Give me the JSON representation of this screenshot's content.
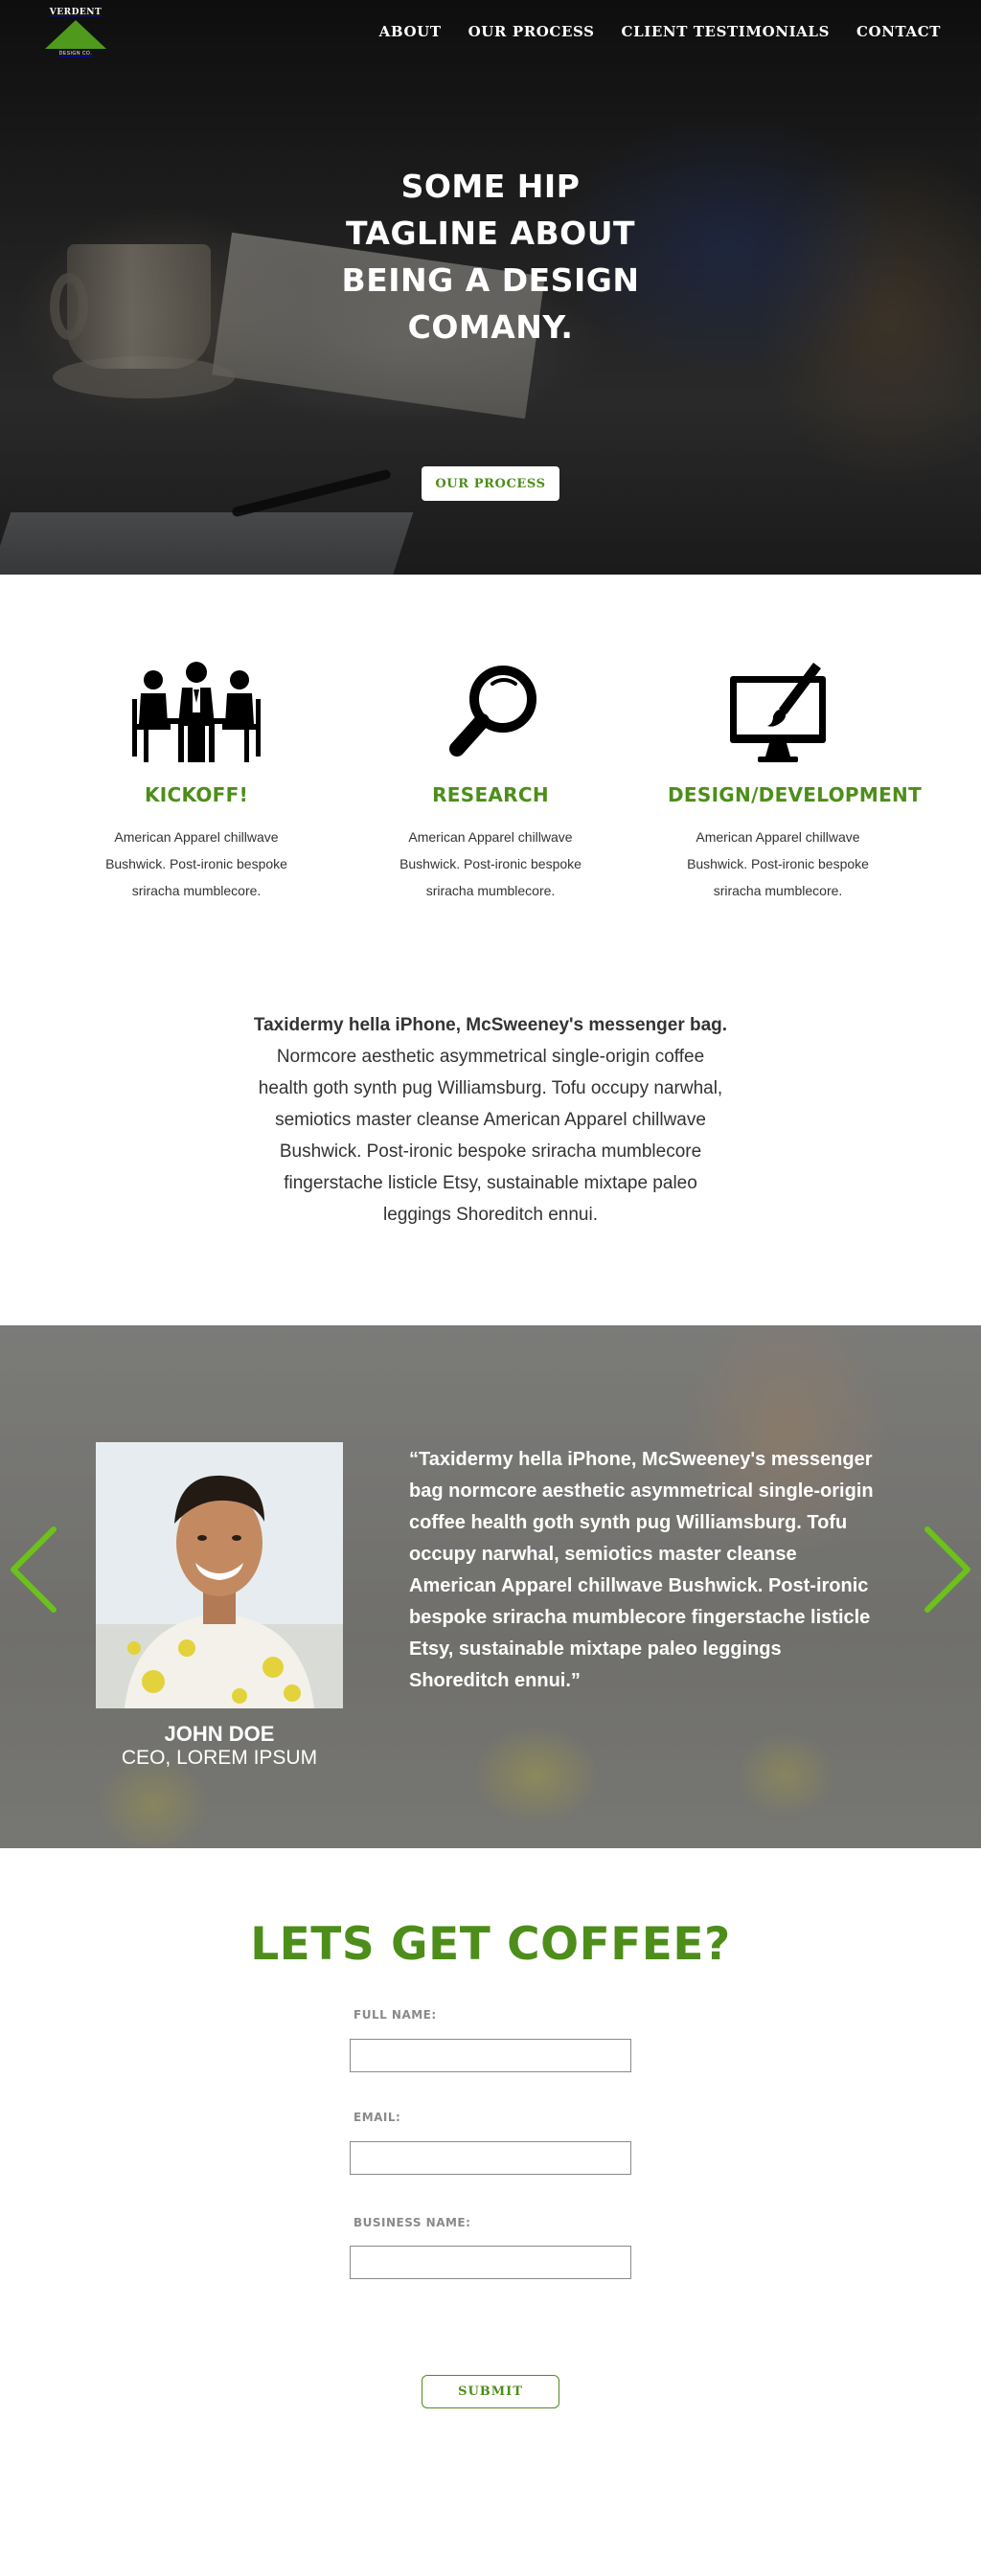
{
  "brand": {
    "name": "VERDENT",
    "sub": "DESIGN CO.",
    "accent": "#4d8e1a",
    "arrow_color": "#6cc11c"
  },
  "nav": {
    "items": [
      "ABOUT",
      "OUR PROCESS",
      "CLIENT TESTIMONIALS",
      "CONTACT"
    ]
  },
  "hero": {
    "tagline": {
      "w1": "SOME ",
      "w2": "HIP",
      "w3": "TAGLINE ABOUT",
      "w4": "BEING A ",
      "w5": "DESIGN",
      "w6": "COMANY."
    },
    "button_label": "OUR PROCESS"
  },
  "process": {
    "steps": [
      {
        "title": "KICKOFF!",
        "icon": "meeting-icon",
        "text": "American Apparel chillwave Bushwick. Post-ironic bespoke sriracha mumblecore."
      },
      {
        "title": "RESEARCH",
        "icon": "magnifier-icon",
        "text": "American Apparel chillwave Bushwick. Post-ironic bespoke sriracha mumblecore."
      },
      {
        "title": "DESIGN/DEVELOPMENT",
        "icon": "monitor-brush-icon",
        "text": "American Apparel chillwave Bushwick. Post-ironic bespoke sriracha mumblecore."
      }
    ]
  },
  "intro": {
    "heading": "Taxidermy hella iPhone, McSweeney's messenger bag.",
    "body": "Normcore aesthetic asymmetrical single-origin coffee health goth synth pug Williamsburg. Tofu occupy narwhal, semiotics master cleanse American Apparel chillwave Bushwick. Post-ironic bespoke sriracha mumblecore fingerstache listicle Etsy, sustainable mixtape paleo leggings Shoreditch ennui."
  },
  "testimonial": {
    "quote": "“Taxidermy hella iPhone, McSweeney's messenger bag normcore aesthetic asymmetrical single-origin coffee health goth synth pug Williamsburg. Tofu occupy narwhal, semiotics master cleanse American Apparel chillwave Bushwick. Post-ironic bespoke sriracha mumblecore fingerstache listicle Etsy, sustainable mixtape paleo leggings Shoreditch ennui.”",
    "name": "JOHN DOE",
    "role": "CEO, LOREM IPSUM"
  },
  "contact": {
    "title": "LETS GET COFFEE?",
    "fields": [
      {
        "label": "FULL NAME:",
        "value": ""
      },
      {
        "label": "EMAIL:",
        "value": ""
      },
      {
        "label": "BUSINESS NAME:",
        "value": ""
      }
    ],
    "submit_label": "SUBMIT"
  }
}
